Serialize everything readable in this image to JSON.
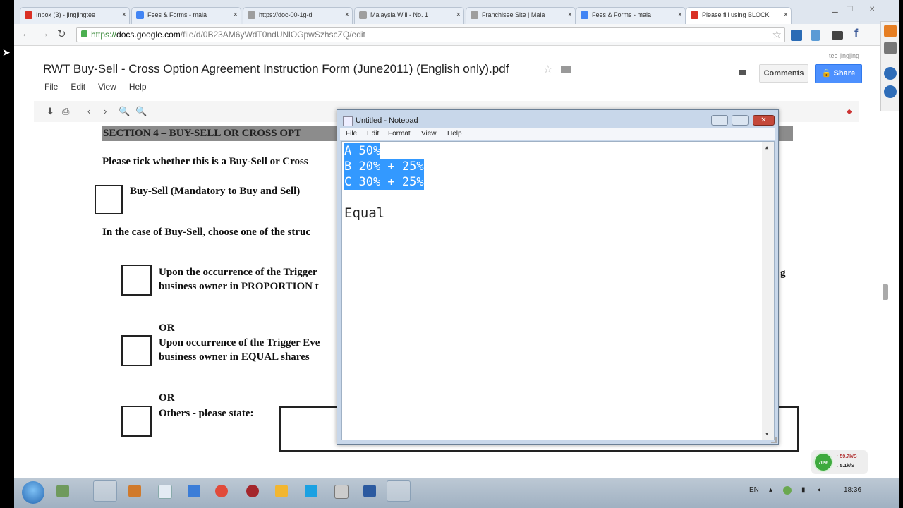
{
  "browser": {
    "tabs": [
      {
        "label": "Inbox (3) - jingjingtee",
        "icon_color": "#d93025"
      },
      {
        "label": "Fees & Forms - mala",
        "icon_color": "#4285f4"
      },
      {
        "label": "https://doc-00-1g-d",
        "icon_color": "#9e9e9e"
      },
      {
        "label": "Malaysia Will - No. 1",
        "icon_color": "#9e9e9e"
      },
      {
        "label": "Franchisee Site | Mala",
        "icon_color": "#9e9e9e"
      },
      {
        "label": "Fees & Forms - mala",
        "icon_color": "#4285f4"
      },
      {
        "label": "Please fill using BLOCK",
        "icon_color": "#d93025"
      }
    ],
    "url_scheme": "https://",
    "url_host": "docs.google.com",
    "url_path": "/file/d/0B23AM6yWdT0ndUNlOGpwSzhscZQ/edit"
  },
  "docs": {
    "title": "RWT Buy-Sell - Cross Option Agreement Instruction Form (June2011) (English only).pdf",
    "menu": [
      "File",
      "Edit",
      "View",
      "Help"
    ],
    "user": "tee jingjing",
    "comments_label": "Comments",
    "share_label": "Share",
    "accent": "#4d90fe"
  },
  "pdf": {
    "section_heading": "SECTION 4 – BUY-SELL OR CROSS OPT",
    "tick_prompt": "Please tick whether this is a Buy-Sell or Cross",
    "opt_buysell": "Buy-Sell (Mandatory to Buy and Sell)",
    "case_prompt": "In the case of Buy-Sell, choose one of the struc",
    "opt1_line1": "Upon the occurrence of the Trigger",
    "opt1_line2": "business owner in PROPORTION t",
    "opt1_tail": "g",
    "or1": "OR",
    "opt2_line1": "Upon occurrence of the Trigger Eve",
    "opt2_line2": "business owner in EQUAL shares",
    "or2": "OR",
    "opt3": "Others - please state:"
  },
  "notepad": {
    "title": "Untitled - Notepad",
    "menu": [
      "File",
      "Edit",
      "Format",
      "View",
      "Help"
    ],
    "lines": [
      "A 50%",
      "B 20% + 25%",
      "C 30% + 25%",
      "",
      "Equal"
    ]
  },
  "netmeter": {
    "percent": "70%",
    "up": "59.7k/S",
    "down": "5.1k/S"
  },
  "taskbar": {
    "lang": "EN",
    "clock": "18:36"
  }
}
